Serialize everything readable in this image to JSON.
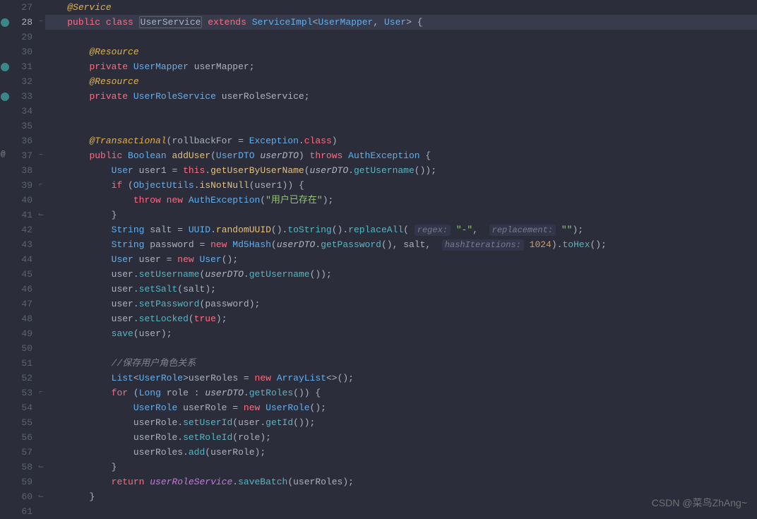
{
  "watermark": "CSDN @菜鸟ZhAng~",
  "lines": {
    "start": 27,
    "end": 61,
    "current": 28
  },
  "gutter_icons": [
    {
      "line": 28,
      "color": "#3B8686",
      "title": "bean-icon"
    },
    {
      "line": 31,
      "color": "#3B8686",
      "title": "bean-icon"
    },
    {
      "line": 33,
      "color": "#3B8686",
      "title": "bean-icon"
    },
    {
      "line": 37,
      "color": "#888",
      "title": "at-icon",
      "text": "@"
    }
  ],
  "fold_marks": {
    "28": "−",
    "37": "−",
    "39": "⌐",
    "41": "⌙",
    "52": "",
    "53": "⌐",
    "58": "⌙",
    "60": "⌙"
  },
  "tokens": {
    "27": [
      {
        "c": "anno",
        "t": "@Service"
      }
    ],
    "28": [
      {
        "c": "kw",
        "t": "public "
      },
      {
        "c": "kw",
        "t": "class "
      },
      {
        "c": "type boxed",
        "t": "UserService"
      },
      {
        "c": "punct",
        "t": " "
      },
      {
        "c": "kw",
        "t": "extends "
      },
      {
        "c": "cls",
        "t": "ServiceImpl"
      },
      {
        "c": "punct",
        "t": "<"
      },
      {
        "c": "cls",
        "t": "UserMapper"
      },
      {
        "c": "punct",
        "t": ", "
      },
      {
        "c": "cls",
        "t": "User"
      },
      {
        "c": "punct",
        "t": ">"
      },
      {
        "c": "punct",
        "t": " {"
      }
    ],
    "29": [],
    "30": [
      {
        "c": "",
        "t": "    "
      },
      {
        "c": "anno",
        "t": "@Resource"
      }
    ],
    "31": [
      {
        "c": "",
        "t": "    "
      },
      {
        "c": "kw",
        "t": "private "
      },
      {
        "c": "cls",
        "t": "UserMapper "
      },
      {
        "c": "var",
        "t": "userMapper"
      },
      {
        "c": "punct",
        "t": ";"
      }
    ],
    "32": [
      {
        "c": "",
        "t": "    "
      },
      {
        "c": "anno",
        "t": "@Resource"
      }
    ],
    "33": [
      {
        "c": "",
        "t": "    "
      },
      {
        "c": "kw",
        "t": "private "
      },
      {
        "c": "cls",
        "t": "UserRoleService "
      },
      {
        "c": "var",
        "t": "userRoleService"
      },
      {
        "c": "punct",
        "t": ";"
      }
    ],
    "34": [],
    "35": [],
    "36": [
      {
        "c": "",
        "t": "    "
      },
      {
        "c": "anno",
        "t": "@Transactional"
      },
      {
        "c": "punct",
        "t": "("
      },
      {
        "c": "var",
        "t": "rollbackFor "
      },
      {
        "c": "punct",
        "t": "= "
      },
      {
        "c": "cls",
        "t": "Exception"
      },
      {
        "c": "punct",
        "t": "."
      },
      {
        "c": "kw",
        "t": "class"
      },
      {
        "c": "punct",
        "t": ")"
      }
    ],
    "37": [
      {
        "c": "",
        "t": "    "
      },
      {
        "c": "kw",
        "t": "public "
      },
      {
        "c": "cls",
        "t": "Boolean "
      },
      {
        "c": "method-y",
        "t": "addUser"
      },
      {
        "c": "punct",
        "t": "("
      },
      {
        "c": "cls",
        "t": "UserDTO "
      },
      {
        "c": "param",
        "t": "userDTO"
      },
      {
        "c": "punct",
        "t": ") "
      },
      {
        "c": "kw",
        "t": "throws "
      },
      {
        "c": "cls",
        "t": "AuthException "
      },
      {
        "c": "punct",
        "t": "{"
      }
    ],
    "38": [
      {
        "c": "",
        "t": "        "
      },
      {
        "c": "cls",
        "t": "User "
      },
      {
        "c": "var",
        "t": "user1 "
      },
      {
        "c": "punct",
        "t": "= "
      },
      {
        "c": "kw",
        "t": "this"
      },
      {
        "c": "punct",
        "t": "."
      },
      {
        "c": "method-y",
        "t": "getUserByUserName"
      },
      {
        "c": "punct",
        "t": "("
      },
      {
        "c": "param",
        "t": "userDTO"
      },
      {
        "c": "punct",
        "t": "."
      },
      {
        "c": "method",
        "t": "getUsername"
      },
      {
        "c": "punct",
        "t": "());"
      }
    ],
    "39": [
      {
        "c": "",
        "t": "        "
      },
      {
        "c": "kw",
        "t": "if "
      },
      {
        "c": "punct",
        "t": "("
      },
      {
        "c": "cls",
        "t": "ObjectUtils"
      },
      {
        "c": "punct",
        "t": "."
      },
      {
        "c": "method-y",
        "t": "isNotNull"
      },
      {
        "c": "punct",
        "t": "("
      },
      {
        "c": "var",
        "t": "user1"
      },
      {
        "c": "punct",
        "t": ")) {"
      }
    ],
    "40": [
      {
        "c": "",
        "t": "            "
      },
      {
        "c": "kw",
        "t": "throw "
      },
      {
        "c": "kw",
        "t": "new "
      },
      {
        "c": "cls",
        "t": "AuthException"
      },
      {
        "c": "punct",
        "t": "("
      },
      {
        "c": "str",
        "t": "\"用户已存在\""
      },
      {
        "c": "punct",
        "t": ");"
      }
    ],
    "41": [
      {
        "c": "",
        "t": "        "
      },
      {
        "c": "punct",
        "t": "}"
      }
    ],
    "42": [
      {
        "c": "",
        "t": "        "
      },
      {
        "c": "cls",
        "t": "String "
      },
      {
        "c": "var",
        "t": "salt "
      },
      {
        "c": "punct",
        "t": "= "
      },
      {
        "c": "cls",
        "t": "UUID"
      },
      {
        "c": "punct",
        "t": "."
      },
      {
        "c": "method-y",
        "t": "randomUUID"
      },
      {
        "c": "punct",
        "t": "()."
      },
      {
        "c": "method",
        "t": "toString"
      },
      {
        "c": "punct",
        "t": "()."
      },
      {
        "c": "method",
        "t": "replaceAll"
      },
      {
        "c": "punct",
        "t": "( "
      },
      {
        "c": "hint",
        "t": "regex:"
      },
      {
        "c": "punct",
        "t": " "
      },
      {
        "c": "str",
        "t": "\"-\""
      },
      {
        "c": "punct",
        "t": ",  "
      },
      {
        "c": "hint",
        "t": "replacement:"
      },
      {
        "c": "punct",
        "t": " "
      },
      {
        "c": "str",
        "t": "\"\""
      },
      {
        "c": "punct",
        "t": ");"
      }
    ],
    "43": [
      {
        "c": "",
        "t": "        "
      },
      {
        "c": "cls",
        "t": "String "
      },
      {
        "c": "var",
        "t": "password "
      },
      {
        "c": "punct",
        "t": "= "
      },
      {
        "c": "kw",
        "t": "new "
      },
      {
        "c": "cls",
        "t": "Md5Hash"
      },
      {
        "c": "punct",
        "t": "("
      },
      {
        "c": "param",
        "t": "userDTO"
      },
      {
        "c": "punct",
        "t": "."
      },
      {
        "c": "method",
        "t": "getPassword"
      },
      {
        "c": "punct",
        "t": "(), "
      },
      {
        "c": "var",
        "t": "salt"
      },
      {
        "c": "punct",
        "t": ",  "
      },
      {
        "c": "hint",
        "t": "hashIterations:"
      },
      {
        "c": "punct",
        "t": " "
      },
      {
        "c": "num",
        "t": "1024"
      },
      {
        "c": "punct",
        "t": ")."
      },
      {
        "c": "method",
        "t": "toHex"
      },
      {
        "c": "punct",
        "t": "();"
      }
    ],
    "44": [
      {
        "c": "",
        "t": "        "
      },
      {
        "c": "cls",
        "t": "User "
      },
      {
        "c": "var",
        "t": "user "
      },
      {
        "c": "punct",
        "t": "= "
      },
      {
        "c": "kw",
        "t": "new "
      },
      {
        "c": "cls",
        "t": "User"
      },
      {
        "c": "punct",
        "t": "();"
      }
    ],
    "45": [
      {
        "c": "",
        "t": "        "
      },
      {
        "c": "var",
        "t": "user"
      },
      {
        "c": "punct",
        "t": "."
      },
      {
        "c": "method",
        "t": "setUsername"
      },
      {
        "c": "punct",
        "t": "("
      },
      {
        "c": "param",
        "t": "userDTO"
      },
      {
        "c": "punct",
        "t": "."
      },
      {
        "c": "method",
        "t": "getUsername"
      },
      {
        "c": "punct",
        "t": "());"
      }
    ],
    "46": [
      {
        "c": "",
        "t": "        "
      },
      {
        "c": "var",
        "t": "user"
      },
      {
        "c": "punct",
        "t": "."
      },
      {
        "c": "method",
        "t": "setSalt"
      },
      {
        "c": "punct",
        "t": "("
      },
      {
        "c": "var",
        "t": "salt"
      },
      {
        "c": "punct",
        "t": ");"
      }
    ],
    "47": [
      {
        "c": "",
        "t": "        "
      },
      {
        "c": "var",
        "t": "user"
      },
      {
        "c": "punct",
        "t": "."
      },
      {
        "c": "method",
        "t": "setPassword"
      },
      {
        "c": "punct",
        "t": "("
      },
      {
        "c": "var",
        "t": "password"
      },
      {
        "c": "punct",
        "t": ");"
      }
    ],
    "48": [
      {
        "c": "",
        "t": "        "
      },
      {
        "c": "var",
        "t": "user"
      },
      {
        "c": "punct",
        "t": "."
      },
      {
        "c": "method",
        "t": "setLocked"
      },
      {
        "c": "punct",
        "t": "("
      },
      {
        "c": "kw",
        "t": "true"
      },
      {
        "c": "punct",
        "t": ");"
      }
    ],
    "49": [
      {
        "c": "",
        "t": "        "
      },
      {
        "c": "method",
        "t": "save"
      },
      {
        "c": "punct",
        "t": "("
      },
      {
        "c": "var",
        "t": "user"
      },
      {
        "c": "punct",
        "t": ");"
      }
    ],
    "50": [],
    "51": [
      {
        "c": "",
        "t": "        "
      },
      {
        "c": "comment",
        "t": "//保存用户角色关系"
      }
    ],
    "52": [
      {
        "c": "",
        "t": "        "
      },
      {
        "c": "cls",
        "t": "List"
      },
      {
        "c": "punct",
        "t": "<"
      },
      {
        "c": "cls",
        "t": "UserRole"
      },
      {
        "c": "punct",
        "t": ">"
      },
      {
        "c": "var",
        "t": "userRoles "
      },
      {
        "c": "punct",
        "t": "= "
      },
      {
        "c": "kw",
        "t": "new "
      },
      {
        "c": "cls",
        "t": "ArrayList"
      },
      {
        "c": "punct",
        "t": "<>();"
      }
    ],
    "53": [
      {
        "c": "",
        "t": "        "
      },
      {
        "c": "kw",
        "t": "for "
      },
      {
        "c": "punct",
        "t": "("
      },
      {
        "c": "cls",
        "t": "Long "
      },
      {
        "c": "var",
        "t": "role "
      },
      {
        "c": "punct",
        "t": ": "
      },
      {
        "c": "param",
        "t": "userDTO"
      },
      {
        "c": "punct",
        "t": "."
      },
      {
        "c": "method",
        "t": "getRoles"
      },
      {
        "c": "punct",
        "t": "()) {"
      }
    ],
    "54": [
      {
        "c": "",
        "t": "            "
      },
      {
        "c": "cls",
        "t": "UserRole "
      },
      {
        "c": "var",
        "t": "userRole "
      },
      {
        "c": "punct",
        "t": "= "
      },
      {
        "c": "kw",
        "t": "new "
      },
      {
        "c": "cls",
        "t": "UserRole"
      },
      {
        "c": "punct",
        "t": "();"
      }
    ],
    "55": [
      {
        "c": "",
        "t": "            "
      },
      {
        "c": "var",
        "t": "userRole"
      },
      {
        "c": "punct",
        "t": "."
      },
      {
        "c": "method",
        "t": "setUserId"
      },
      {
        "c": "punct",
        "t": "("
      },
      {
        "c": "var",
        "t": "user"
      },
      {
        "c": "punct",
        "t": "."
      },
      {
        "c": "method",
        "t": "getId"
      },
      {
        "c": "punct",
        "t": "());"
      }
    ],
    "56": [
      {
        "c": "",
        "t": "            "
      },
      {
        "c": "var",
        "t": "userRole"
      },
      {
        "c": "punct",
        "t": "."
      },
      {
        "c": "method",
        "t": "setRoleId"
      },
      {
        "c": "punct",
        "t": "("
      },
      {
        "c": "var",
        "t": "role"
      },
      {
        "c": "punct",
        "t": ");"
      }
    ],
    "57": [
      {
        "c": "",
        "t": "            "
      },
      {
        "c": "var",
        "t": "userRoles"
      },
      {
        "c": "punct",
        "t": "."
      },
      {
        "c": "method",
        "t": "add"
      },
      {
        "c": "punct",
        "t": "("
      },
      {
        "c": "var",
        "t": "userRole"
      },
      {
        "c": "punct",
        "t": ");"
      }
    ],
    "58": [
      {
        "c": "",
        "t": "        "
      },
      {
        "c": "punct",
        "t": "}"
      }
    ],
    "59": [
      {
        "c": "",
        "t": "        "
      },
      {
        "c": "kw",
        "t": "return "
      },
      {
        "c": "field-i",
        "t": "userRoleService"
      },
      {
        "c": "punct",
        "t": "."
      },
      {
        "c": "method",
        "t": "saveBatch"
      },
      {
        "c": "punct",
        "t": "("
      },
      {
        "c": "var",
        "t": "userRoles"
      },
      {
        "c": "punct",
        "t": ");"
      }
    ],
    "60": [
      {
        "c": "",
        "t": "    "
      },
      {
        "c": "punct",
        "t": "}"
      }
    ],
    "61": []
  }
}
